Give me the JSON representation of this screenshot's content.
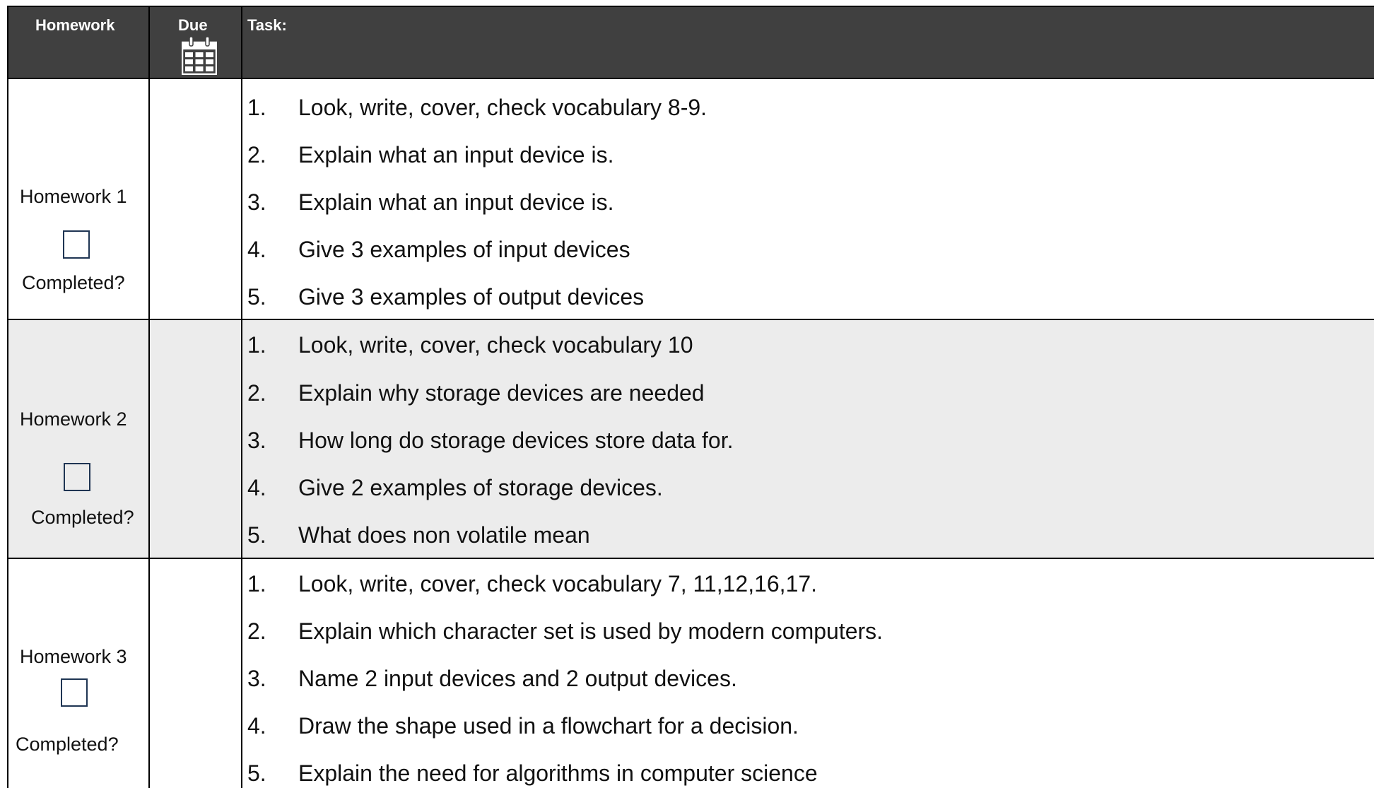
{
  "header": {
    "homework_label": "Homework",
    "due_label": "Due",
    "task_label": "Task:",
    "calendar_icon": "calendar-icon"
  },
  "rows": [
    {
      "label": "Homework 1",
      "completed_label": "Completed?",
      "completed": false,
      "tasks": [
        {
          "num": "1.",
          "text": "Look, write, cover, check vocabulary 8-9."
        },
        {
          "num": "2.",
          "text": "Explain what an input device is."
        },
        {
          "num": "3.",
          "text": "Explain what an input device is."
        },
        {
          "num": "4.",
          "text": "Give 3 examples of input devices"
        },
        {
          "num": "5.",
          "text": "Give 3 examples of output devices"
        }
      ]
    },
    {
      "label": "Homework 2",
      "completed_label": "Completed?",
      "completed": false,
      "tasks": [
        {
          "num": "1.",
          "text": "Look, write, cover, check vocabulary 10"
        },
        {
          "num": "2.",
          "text": "Explain why  storage devices are needed"
        },
        {
          "num": "3.",
          "text": "How long do storage devices store data for."
        },
        {
          "num": "4.",
          "text": "Give 2 examples of storage devices."
        },
        {
          "num": "5.",
          "text": "What does non volatile mean"
        }
      ]
    },
    {
      "label": "Homework 3",
      "completed_label": "Completed?",
      "completed": false,
      "tasks": [
        {
          "num": "1.",
          "text": "Look, write, cover, check vocabulary 7, 11,12,16,17."
        },
        {
          "num": "2.",
          "text": "Explain which character set is used by modern computers."
        },
        {
          "num": "3.",
          "text": "Name 2 input devices and 2 output devices."
        },
        {
          "num": "4.",
          "text": "Draw the shape used in a flowchart for a decision."
        },
        {
          "num": "5.",
          "text": "Explain the need for algorithms in computer science"
        }
      ]
    }
  ],
  "colors": {
    "header_bg": "#404040",
    "header_text": "#ffffff",
    "shaded_row": "#ececec",
    "checkbox_border": "#1f3553"
  }
}
